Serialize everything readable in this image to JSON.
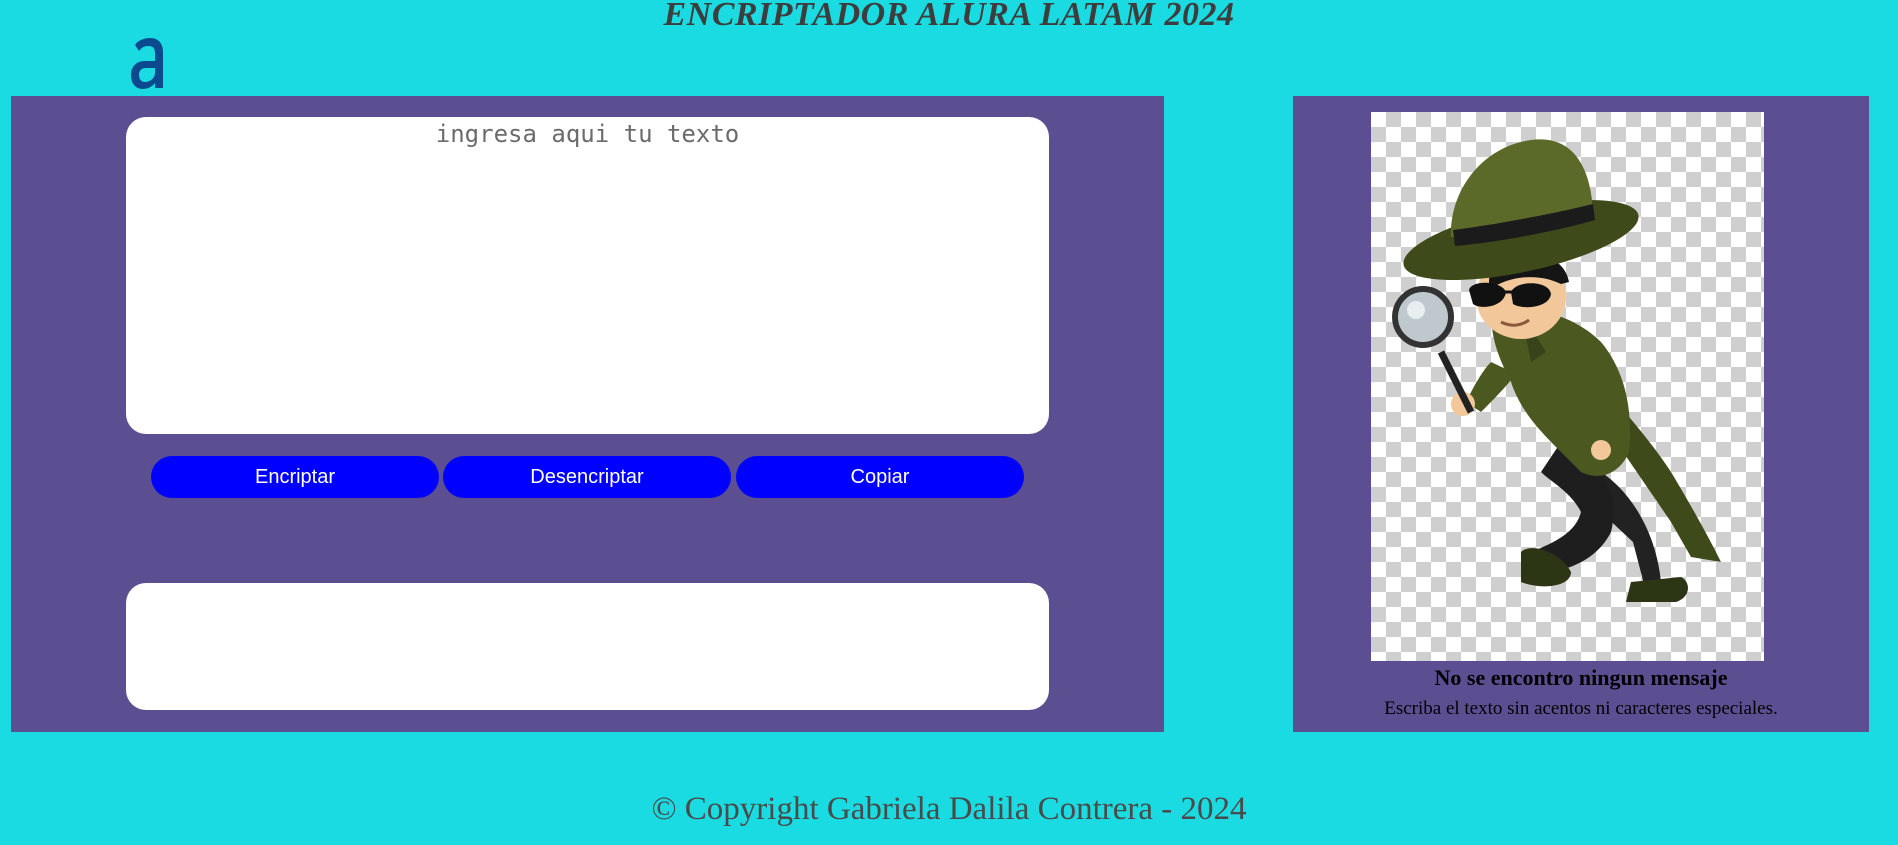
{
  "header": {
    "title": "ENCRIPTADOR ALURA LATAM 2024",
    "logo_icon": "alura-logo-icon"
  },
  "editor": {
    "input_placeholder": "ingresa aqui tu texto",
    "input_value": "",
    "output_value": ""
  },
  "buttons": {
    "encrypt_label": "Encriptar",
    "decrypt_label": "Desencriptar",
    "copy_label": "Copiar"
  },
  "result_panel": {
    "image_name": "detective-illustration",
    "message_title": "No se encontro ningun mensaje",
    "message_hint": "Escriba el texto sin acentos ni caracteres especiales."
  },
  "footer": {
    "copyright": "© Copyright Gabriela Dalila Contrera - 2024"
  },
  "colors": {
    "background": "#19dbe1",
    "panel": "#5b4f92",
    "button": "#0000ff",
    "box": "#ffffff"
  }
}
